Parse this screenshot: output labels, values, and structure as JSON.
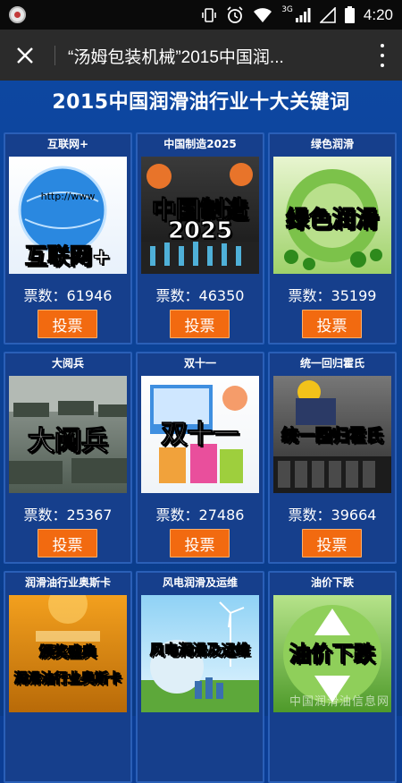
{
  "statusbar": {
    "network": "3G",
    "time": "4:20"
  },
  "appbar": {
    "title": "“汤姆包装机械”2015中国润..."
  },
  "page": {
    "heading": "2015中国润滑油行业十大关键词",
    "watermark": "中国润滑油信息网"
  },
  "cards": [
    {
      "title": "互联网+",
      "image_text": "互联网+",
      "image_sub": "http://www",
      "votes": "票数：61946",
      "button": "投票",
      "theme": "globe"
    },
    {
      "title": "中国制造2025",
      "image_text": "中国制造",
      "image_sub": "2025",
      "votes": "票数：46350",
      "button": "投票",
      "theme": "gears"
    },
    {
      "title": "绿色润滑",
      "image_text": "绿色润滑",
      "image_sub": "",
      "votes": "票数：35199",
      "button": "投票",
      "theme": "green"
    },
    {
      "title": "大阅兵",
      "image_text": "大阅兵",
      "image_sub": "",
      "votes": "票数：25367",
      "button": "投票",
      "theme": "tanks"
    },
    {
      "title": "双十一",
      "image_text": "双十一",
      "image_sub": "",
      "votes": "票数：27486",
      "button": "投票",
      "theme": "shopping"
    },
    {
      "title": "统一回归霍氏",
      "image_text": "统一回归霍氏",
      "image_sub": "",
      "votes": "票数：39664",
      "button": "投票",
      "theme": "factory"
    },
    {
      "title": "润滑油行业奥斯卡",
      "image_text": "润滑油行业奥斯卡",
      "image_sub": "颁奖盛典",
      "votes": "",
      "button": "",
      "theme": "oscar"
    },
    {
      "title": "风电润滑及运维",
      "image_text": "风电润滑及运维",
      "image_sub": "",
      "votes": "",
      "button": "",
      "theme": "wind"
    },
    {
      "title": "油价下跌",
      "image_text": "油价下跌",
      "image_sub": "",
      "votes": "",
      "button": "",
      "theme": "oil"
    }
  ]
}
